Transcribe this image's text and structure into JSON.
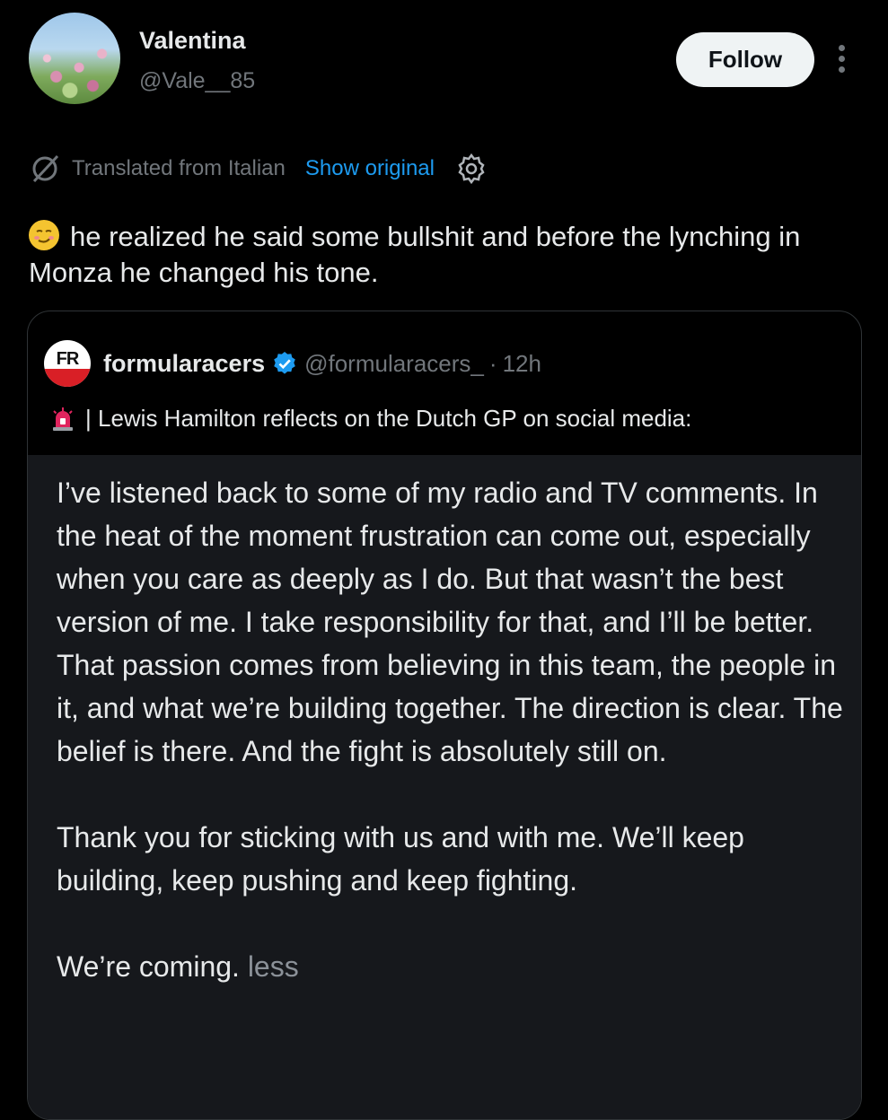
{
  "user": {
    "display_name": "Valentina",
    "handle": "@Vale__85",
    "follow_label": "Follow"
  },
  "translation": {
    "label": "Translated from Italian",
    "show_original": "Show original"
  },
  "tweet": {
    "emoji": "smirking-face-emoji",
    "text": "he realized he said some bullshit and before the lynching in Monza he changed his tone."
  },
  "quote": {
    "name": "formularacers",
    "handle": "@formularacers_",
    "separator": "·",
    "time": "12h",
    "headline": "| Lewis Hamilton reflects on the Dutch GP on social media:",
    "paragraphs": [
      "I’ve listened back to some of my radio and TV comments. In the heat of the moment frustration can come out, especially when you care as deeply as I do. But that wasn’t the best version of me. I take responsibility for that, and I’ll be better. That passion comes from believing in this team, the people in it, and what we’re building together. The direction is clear. The belief is there. And the fight is absolutely still on.",
      "Thank you for sticking with us and with me. We’ll keep building, keep pushing and keep fighting."
    ],
    "closing": "We’re coming.",
    "less_label": "less",
    "logo_text": "FR"
  },
  "colors": {
    "background": "#000000",
    "text": "#e7e9ea",
    "muted": "#71767b",
    "link": "#1d9bf0",
    "card": "#16181c",
    "verified": "#1d9bf0"
  }
}
